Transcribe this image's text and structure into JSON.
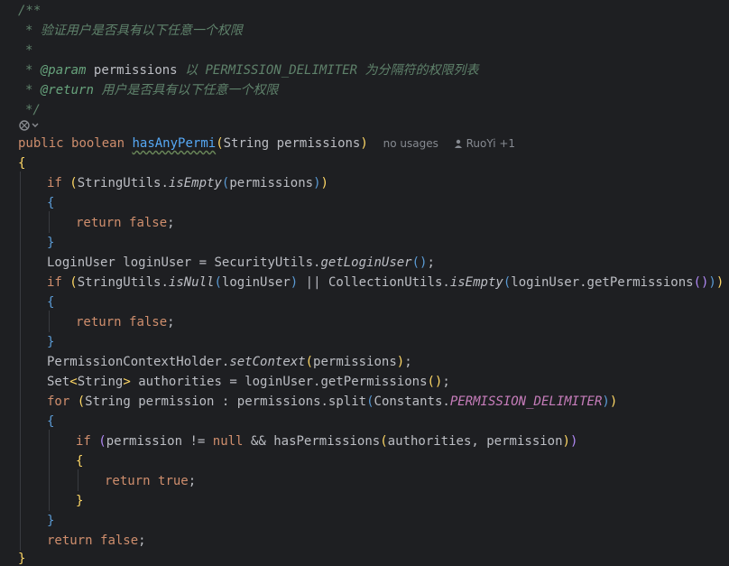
{
  "doc": {
    "open": "/**",
    "desc": "验证用户是否具有以下任意一个权限",
    "star": "*",
    "param_tag": "@param",
    "param_name": "permissions",
    "param_desc_1": "以",
    "param_const": "PERMISSION_DELIMITER",
    "param_desc_2": "为分隔符的权限列表",
    "return_tag": "@return",
    "return_desc": "用户是否具有以下任意一个权限",
    "close": "*/"
  },
  "signature": {
    "kw_public": "public",
    "kw_boolean": "boolean",
    "method": "hasAnyPermi",
    "param_type": "String",
    "param_name": "permissions",
    "usages_hint": "no usages",
    "author_hint": "RuoYi +1"
  },
  "code": {
    "brace_open": "{",
    "brace_close": "}",
    "if": "if",
    "return": "return",
    "false": "false",
    "true": "true",
    "for": "for",
    "l1_class": "StringUtils",
    "l1_method": "isEmpty",
    "l1_arg": "permissions",
    "l4_type": "LoginUser",
    "l4_var": "loginUser",
    "l4_class": "SecurityUtils",
    "l4_method": "getLoginUser",
    "l5_class": "StringUtils",
    "l5_method": "isNull",
    "l5_arg": "loginUser",
    "l5_op": "||",
    "l5_class2": "CollectionUtils",
    "l5_method2": "isEmpty",
    "l5_arg2": "loginUser.getPermissions",
    "l9_class": "PermissionContextHolder",
    "l9_method": "setContext",
    "l9_arg": "permissions",
    "l10_type": "Set",
    "l10_generic": "String",
    "l10_var": "authorities",
    "l10_expr": "loginUser.getPermissions",
    "l11_type": "String",
    "l11_var": "permission",
    "l11_expr": "permissions.split",
    "l11_class": "Constants",
    "l11_const": "PERMISSION_DELIMITER",
    "l13_var": "permission",
    "l13_op": "!=",
    "l13_null": "null",
    "l13_and": "&&",
    "l13_call": "hasPermissions",
    "l13_args": "authorities, permission"
  }
}
